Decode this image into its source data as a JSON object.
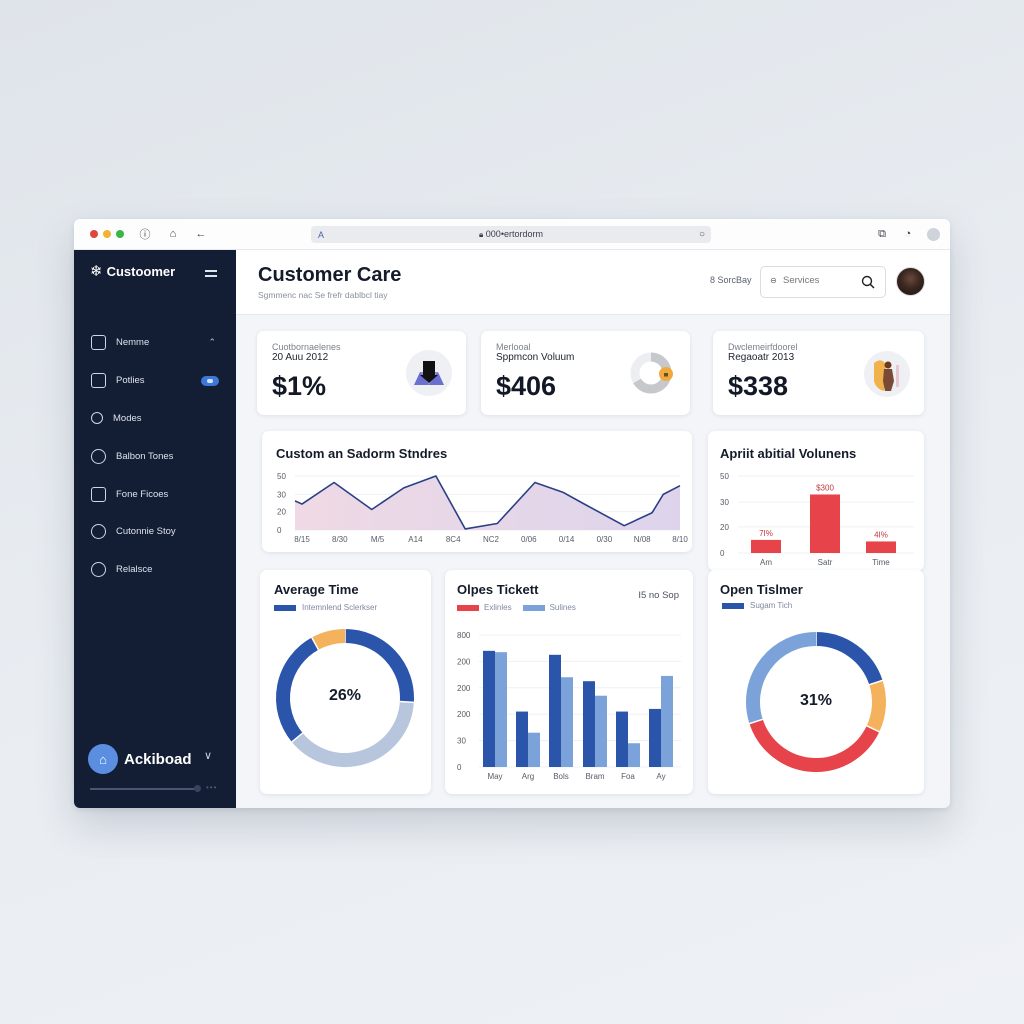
{
  "browser": {
    "url": "000•ertordorm",
    "traffic_lights": [
      "#e0443e",
      "#f2b233",
      "#3bb54a"
    ],
    "left_icons": [
      "info-icon",
      "share-icon",
      "back-arrow-icon"
    ],
    "right_icons": [
      "extension-icon",
      "history-icon",
      "profile-icon"
    ]
  },
  "sidebar": {
    "brand_name": "Custoomer",
    "items": [
      {
        "label": "Nemme",
        "icon": "hierarchy-icon",
        "trailing": "chevron-up"
      },
      {
        "label": "Potlies",
        "icon": "document-icon",
        "trailing": "toggle"
      },
      {
        "label": "Modes",
        "icon": "nodes-icon"
      },
      {
        "label": "Balbon Tones",
        "icon": "check-circle-icon"
      },
      {
        "label": "Fone Ficoes",
        "icon": "laptop-icon"
      },
      {
        "label": "Cutonnie Stoy",
        "icon": "circle-icon"
      },
      {
        "label": "Relalsce",
        "icon": "circle-outline-icon"
      }
    ],
    "account": {
      "name": "Ackiboad",
      "more": "•••"
    }
  },
  "header": {
    "title": "Customer Care",
    "subtitle": "Sgmmenc nac Se frefr dablbcl tiay",
    "link": "8 SorcBay",
    "search_placeholder": "Services",
    "search_prefix": "🔒"
  },
  "kpis": [
    {
      "label": "Cuotbornaelenes",
      "sub": "20 Auu 2012",
      "value": "$1%"
    },
    {
      "label": "Merlooal",
      "sub": "Sppmcon Voluum",
      "value": "$406"
    },
    {
      "label": "Dwclemeirfdoorel",
      "sub": "Regaoatr 2013",
      "value": "$338"
    }
  ],
  "colors": {
    "navy": "#131d33",
    "blue_dark": "#2b55ab",
    "blue_light": "#7ba3da",
    "red": "#e6434a",
    "orange": "#f4b25c",
    "grey_blue": "#b7c5dd",
    "line": "#2a3f86",
    "area": "#e6d6ea"
  },
  "chart_data": [
    {
      "type": "area",
      "title": "Custom an Sadorm Stndres",
      "xlabel": "",
      "ylabel": "",
      "ylim": [
        0,
        50
      ],
      "yticks": [
        "0",
        "20",
        "30",
        "50"
      ],
      "ytick_values": [
        0,
        17,
        33,
        50
      ],
      "x": [
        "8/15",
        "8/30",
        "M/5",
        "A14",
        "8C4",
        "NC2",
        "0/06",
        "0/14",
        "0/30",
        "N/08",
        "8/10"
      ],
      "points": [
        {
          "x": 0,
          "y": 27
        },
        {
          "x": 0.25,
          "y": 24
        },
        {
          "x": 1.4,
          "y": 44
        },
        {
          "x": 2.75,
          "y": 19
        },
        {
          "x": 3.9,
          "y": 39
        },
        {
          "x": 5.05,
          "y": 50
        },
        {
          "x": 6.1,
          "y": 1
        },
        {
          "x": 7.25,
          "y": 6
        },
        {
          "x": 8.6,
          "y": 44
        },
        {
          "x": 9.6,
          "y": 35
        },
        {
          "x": 10.3,
          "y": 25
        },
        {
          "x": 11.8,
          "y": 4
        },
        {
          "x": 12.8,
          "y": 16
        },
        {
          "x": 13.2,
          "y": 33
        },
        {
          "x": 13.8,
          "y": 41
        }
      ],
      "x_domain": [
        0,
        13.8
      ]
    },
    {
      "type": "bar",
      "title": "Apriit abitial Volunens",
      "ylim": [
        0,
        50
      ],
      "yticks": [
        "0",
        "20",
        "30",
        "50"
      ],
      "ytick_values": [
        0,
        17,
        33,
        50
      ],
      "categories": [
        "Am",
        "Satr",
        "Time"
      ],
      "values": [
        8.5,
        38,
        7.5
      ],
      "data_labels": [
        "7I%",
        "$300",
        "4I%"
      ]
    },
    {
      "type": "pie",
      "title": "Average Time",
      "legend": [
        "Intemnlend Sclerkser"
      ],
      "center_label": "26%",
      "slices": [
        {
          "label": "segment-a",
          "value": 26,
          "color": "#2b55ab"
        },
        {
          "label": "segment-b",
          "value": 38,
          "color": "#b7c5dd"
        },
        {
          "label": "segment-c",
          "value": 28,
          "color": "#2b55ab"
        },
        {
          "label": "segment-d",
          "value": 8,
          "color": "#f4b25c"
        }
      ]
    },
    {
      "type": "bar",
      "title": "Olpes Tickett",
      "annotation": "I5 no Sop",
      "legend": [
        {
          "name": "Exlinles",
          "color": "#e6434a"
        },
        {
          "name": "Sulines",
          "color": "#7ba3da"
        }
      ],
      "yticks": [
        "0",
        "30",
        "200",
        "200",
        "200",
        "800"
      ],
      "ytick_values": [
        0,
        1,
        2,
        3,
        4,
        5
      ],
      "ylim": [
        0,
        5
      ],
      "categories": [
        "May",
        "Arg",
        "Bols",
        "Bram",
        "Foa",
        "Ay"
      ],
      "series": [
        {
          "name": "Exlinles",
          "values": [
            4.4,
            2.1,
            4.25,
            3.25,
            2.1,
            2.2
          ],
          "color": "#2b55ab"
        },
        {
          "name": "Sulines",
          "values": [
            4.35,
            1.3,
            3.4,
            2.7,
            0.9,
            3.45
          ],
          "color": "#7ba3da"
        }
      ]
    },
    {
      "type": "pie",
      "title": "Open Tislmer",
      "legend": [
        "Sugam Tich"
      ],
      "center_label": "31%",
      "slices": [
        {
          "label": "segment-a",
          "value": 20,
          "color": "#2b55ab"
        },
        {
          "label": "segment-b",
          "value": 12,
          "color": "#f4b25c"
        },
        {
          "label": "segment-c",
          "value": 38,
          "color": "#e6434a"
        },
        {
          "label": "segment-d",
          "value": 30,
          "color": "#7ba3da"
        }
      ]
    }
  ]
}
